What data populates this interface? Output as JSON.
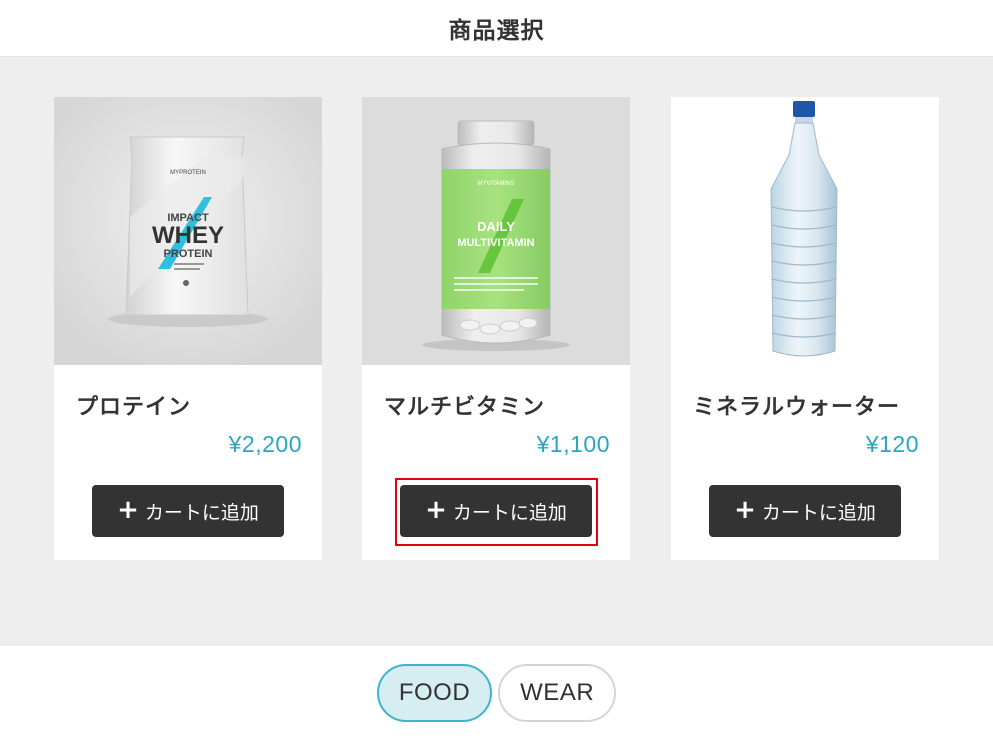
{
  "header": {
    "title": "商品選択"
  },
  "products": [
    {
      "name": "プロテイン",
      "price": "¥2,200",
      "button_label": "カートに追加",
      "image": "protein-bag-icon"
    },
    {
      "name": "マルチビタミン",
      "price": "¥1,100",
      "button_label": "カートに追加",
      "image": "vitamin-bottle-icon"
    },
    {
      "name": "ミネラルウォーター",
      "price": "¥120",
      "button_label": "カートに追加",
      "image": "water-bottle-icon"
    }
  ],
  "images": {
    "protein": {
      "brand": "MYPROTEIN",
      "line1": "IMPACT",
      "line2": "WHEY",
      "line3": "PROTEIN"
    },
    "vitamin": {
      "brand": "MYVITAMINS",
      "line1": "DAILY",
      "line2": "MULTIVITAMIN"
    }
  },
  "tabs": [
    {
      "label": "FOOD",
      "active": true
    },
    {
      "label": "WEAR",
      "active": false
    }
  ],
  "colors": {
    "accent": "#2aa7c0",
    "button": "#333333",
    "highlight": "#e3000f",
    "tab_active_bg": "#d6eef2"
  }
}
